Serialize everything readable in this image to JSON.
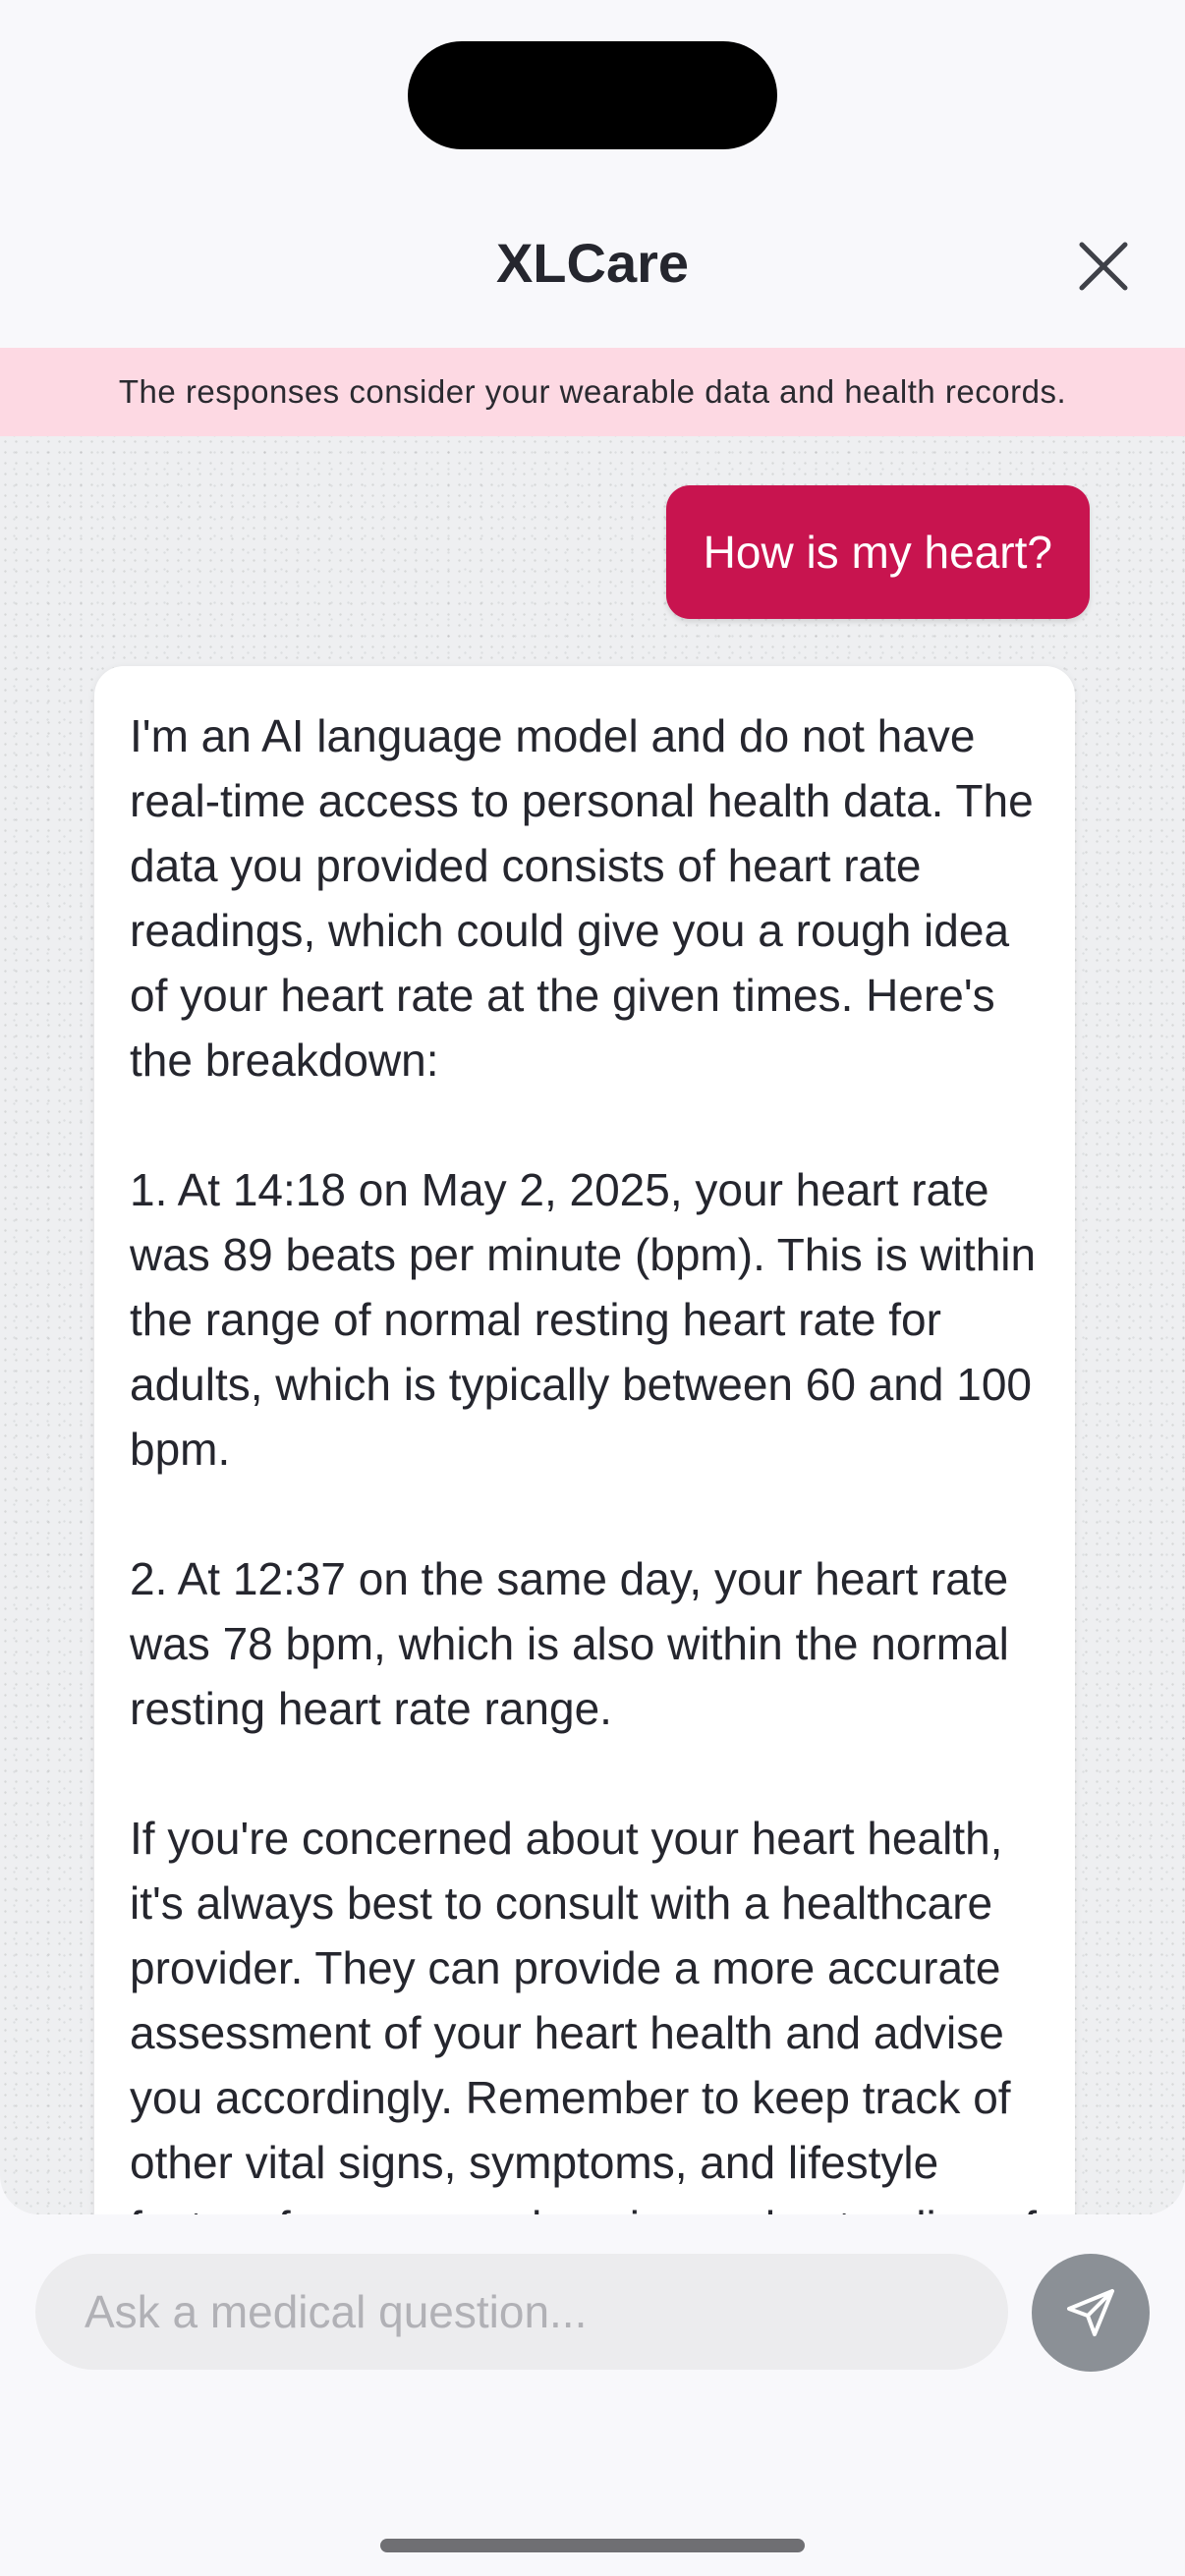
{
  "app": {
    "title": "XLCare"
  },
  "banner": {
    "text": "The responses consider your wearable data and health records."
  },
  "chat": {
    "user_message": "How is my heart?",
    "ai_message": "I'm an AI language model and do not have real-time access to personal health data. The data you provided consists of heart rate readings, which could give you a rough idea of your heart rate at the given times. Here's the breakdown:\n\n1. At 14:18 on May 2, 2025, your heart rate was 89 beats per minute (bpm). This is within the range of normal resting heart rate for adults, which is typically between 60 and 100 bpm.\n\n2. At 12:37 on the same day, your heart rate was 78 bpm, which is also within the normal resting heart rate range.\n\nIf you're concerned about your heart health, it's always best to consult with a healthcare provider. They can provide a more accurate assessment of your heart health and advise you accordingly. Remember to keep track of other vital signs, symptoms, and lifestyle factors for a comprehensive understanding of your health."
  },
  "input": {
    "placeholder": "Ask a medical question..."
  },
  "icons": {
    "close": "close-icon",
    "send": "send-icon"
  },
  "colors": {
    "accent": "#c8144f",
    "banner_bg": "#fdd9e3",
    "send_button": "#8b9096"
  }
}
